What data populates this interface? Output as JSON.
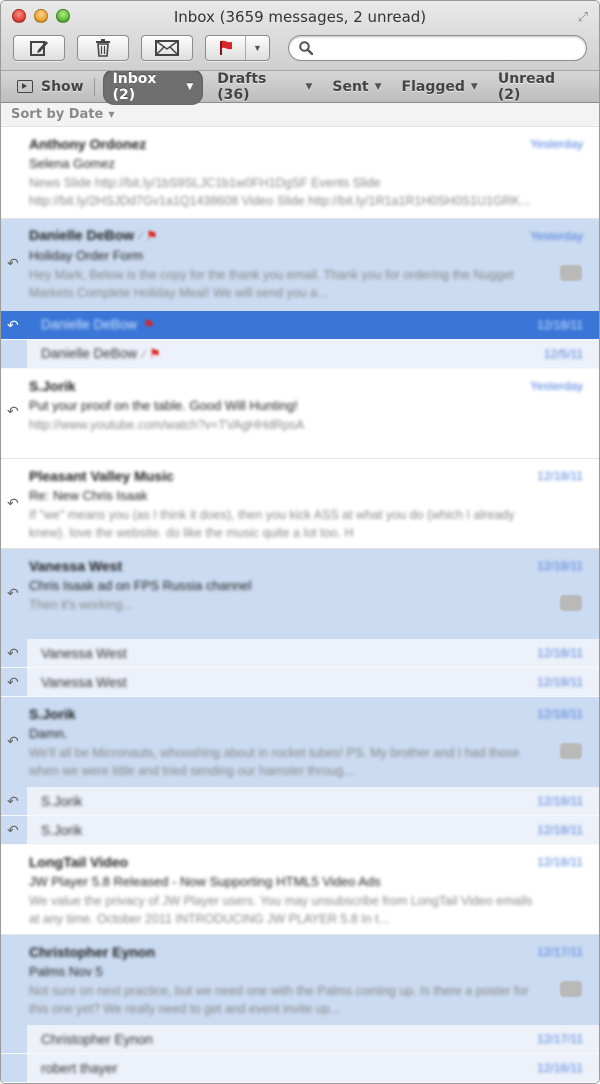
{
  "window": {
    "title": "Inbox (3659 messages, 2 unread)"
  },
  "toolbar": {
    "buttons": [
      {
        "name": "compose",
        "icon": "compose-icon"
      },
      {
        "name": "delete",
        "icon": "trash-icon"
      },
      {
        "name": "get-mail",
        "icon": "envelope-icon"
      },
      {
        "name": "flag",
        "icon": "flag-icon",
        "color": "#d9262b"
      }
    ],
    "search": {
      "placeholder": "",
      "value": ""
    }
  },
  "favorites": {
    "show_label": "Show",
    "items": [
      {
        "label": "Inbox (2)",
        "active": true,
        "has_menu": true
      },
      {
        "label": "Drafts (36)",
        "active": false,
        "has_menu": true
      },
      {
        "label": "Sent",
        "active": false,
        "has_menu": true
      },
      {
        "label": "Flagged",
        "active": false,
        "has_menu": true
      },
      {
        "label": "Unread (2)",
        "active": false,
        "has_menu": false
      }
    ]
  },
  "sort": {
    "label": "Sort by Date"
  },
  "messages": [
    {
      "sender": "Anthony Ordonez",
      "date": "Yesterday",
      "subject": "Selena Gomez",
      "preview": "News Slide http://bit.ly/1bS9SLJC1b1w0FH1DgSF Events Slide http://bit.ly/2HSJDd7Gv1a1Q1438608 Video Slide http://bit.ly/1R1a1R1H0SH0S1U1GRK...",
      "replied": false,
      "selected": false
    },
    {
      "sender": "Danielle DeBow",
      "date": "Yesterday",
      "subject": "Holiday Order Form",
      "preview": "Hey Mark, Below is the copy for the thank you email. Thank you for ordering the Nugget Markets Complete Holiday Meal! We will send you a...",
      "replied": true,
      "selected": true,
      "attachment": true,
      "flagged": true,
      "count_badge": true,
      "thread": [
        {
          "sender": "Danielle DeBow",
          "date": "12/18/11",
          "flagged": true,
          "attachment": false,
          "replied": true,
          "active": true
        },
        {
          "sender": "Danielle DeBow",
          "date": "12/5/11",
          "flagged": true,
          "attachment": true,
          "replied": false,
          "active": false
        }
      ]
    },
    {
      "sender": "S.Jorik",
      "date": "Yesterday",
      "subject": "Put your proof on the table. Good Will Hunting!",
      "preview": "http://www.youtube.com/watch?v=TVAgHHdRpsA",
      "replied": true,
      "selected": false
    },
    {
      "sender": "Pleasant Valley Music",
      "date": "12/18/11",
      "subject": "Re: New Chris Isaak",
      "preview": "If \"we\" means you (as I think it does), then you kick ASS at what you do (which I already knew). love the website. do like the music quite a lot too. H",
      "replied": true,
      "selected": false
    },
    {
      "sender": "Vanessa West",
      "date": "12/18/11",
      "subject": "Chris Isaak ad on FPS Russia channel",
      "preview": "Then it's working...",
      "replied": true,
      "selected": true,
      "count_badge": true,
      "thread": [
        {
          "sender": "Vanessa West",
          "date": "12/18/11",
          "replied": true,
          "active": false
        },
        {
          "sender": "Vanessa West",
          "date": "12/18/11",
          "replied": true,
          "active": false
        }
      ]
    },
    {
      "sender": "S.Jorik",
      "date": "12/18/11",
      "subject": "Damn.",
      "preview": "We'll all be Micronauts, whooshing about in rocket tubes! PS. My brother and I had those when we were little and tried sending our hamster throug...",
      "replied": true,
      "selected": true,
      "count_badge": true,
      "thread": [
        {
          "sender": "S.Jorik",
          "date": "12/18/11",
          "replied": true,
          "active": false
        },
        {
          "sender": "S.Jorik",
          "date": "12/18/11",
          "replied": true,
          "active": false
        }
      ]
    },
    {
      "sender": "LongTail Video",
      "date": "12/18/11",
      "subject": "JW Player 5.8 Released - Now Supporting HTML5 Video Ads",
      "preview": "We value the privacy of JW Player users. You may unsubscribe from LongTail Video emails at any time. October 2011 INTRODUCING JW PLAYER 5.8 In t...",
      "replied": false,
      "selected": false
    },
    {
      "sender": "Christopher Eynon",
      "date": "12/17/11",
      "subject": "Palms Nov 5",
      "preview": "Not sure on next practice, but we need one with the Palms coming up. Is there a poster for this one yet? We really need to get and event invite up...",
      "replied": false,
      "selected": true,
      "count_badge": true,
      "thread": [
        {
          "sender": "Christopher Eynon",
          "date": "12/17/11",
          "replied": false,
          "active": false
        },
        {
          "sender": "robert thayer",
          "date": "12/16/11",
          "replied": false,
          "active": false
        }
      ]
    }
  ]
}
